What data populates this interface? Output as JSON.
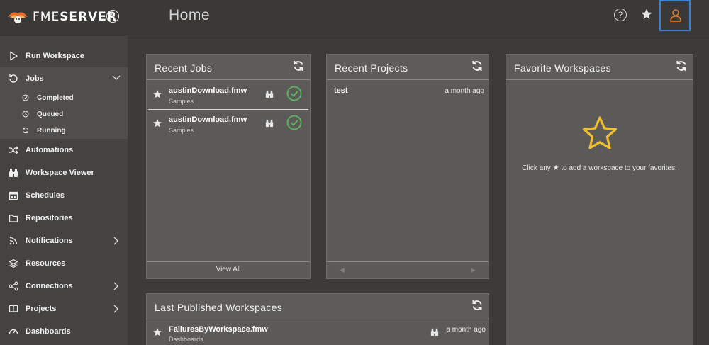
{
  "app": {
    "brand_fme": "FME",
    "brand_server": "SERVER"
  },
  "header": {
    "title": "Home",
    "help_icon": "question-circle-icon",
    "favorites_icon": "star-icon",
    "user_icon": "user-icon",
    "accent": "#3f7fd0"
  },
  "sidebar": {
    "items": [
      {
        "label": "Run Workspace",
        "icon": "play-icon"
      },
      {
        "label": "Jobs",
        "icon": "jobs-icon"
      },
      {
        "label": "Automations",
        "icon": "shuffle-icon"
      },
      {
        "label": "Workspace Viewer",
        "icon": "binoculars-icon"
      },
      {
        "label": "Schedules",
        "icon": "calendar-icon"
      },
      {
        "label": "Repositories",
        "icon": "folder-icon"
      },
      {
        "label": "Notifications",
        "icon": "rss-icon"
      },
      {
        "label": "Resources",
        "icon": "layers-icon"
      },
      {
        "label": "Connections",
        "icon": "share-icon"
      },
      {
        "label": "Projects",
        "icon": "book-icon"
      },
      {
        "label": "Dashboards",
        "icon": "gauge-icon"
      }
    ],
    "jobs_sub": [
      {
        "label": "Completed",
        "icon": "check-circle-icon"
      },
      {
        "label": "Queued",
        "icon": "clock-icon"
      },
      {
        "label": "Running",
        "icon": "refresh-icon"
      }
    ]
  },
  "recent_jobs": {
    "title": "Recent Jobs",
    "rows": [
      {
        "name": "austinDownload.fmw",
        "repo": "Samples",
        "status": "success"
      },
      {
        "name": "austinDownload.fmw",
        "repo": "Samples",
        "status": "success"
      }
    ],
    "footer": "View All",
    "success_color": "#5cb85c"
  },
  "recent_projects": {
    "title": "Recent Projects",
    "rows": [
      {
        "name": "test",
        "when": "a month ago"
      }
    ],
    "prev": "◀",
    "next": "▶"
  },
  "favorite_workspaces": {
    "title": "Favorite Workspaces",
    "empty_before": "Click any",
    "empty_after": "to add a workspace to your favorites.",
    "star_color": "#f0c030"
  },
  "last_published": {
    "title": "Last Published Workspaces",
    "rows": [
      {
        "name": "FailuresByWorkspace.fmw",
        "repo": "Dashboards",
        "when": "a month ago"
      }
    ]
  }
}
